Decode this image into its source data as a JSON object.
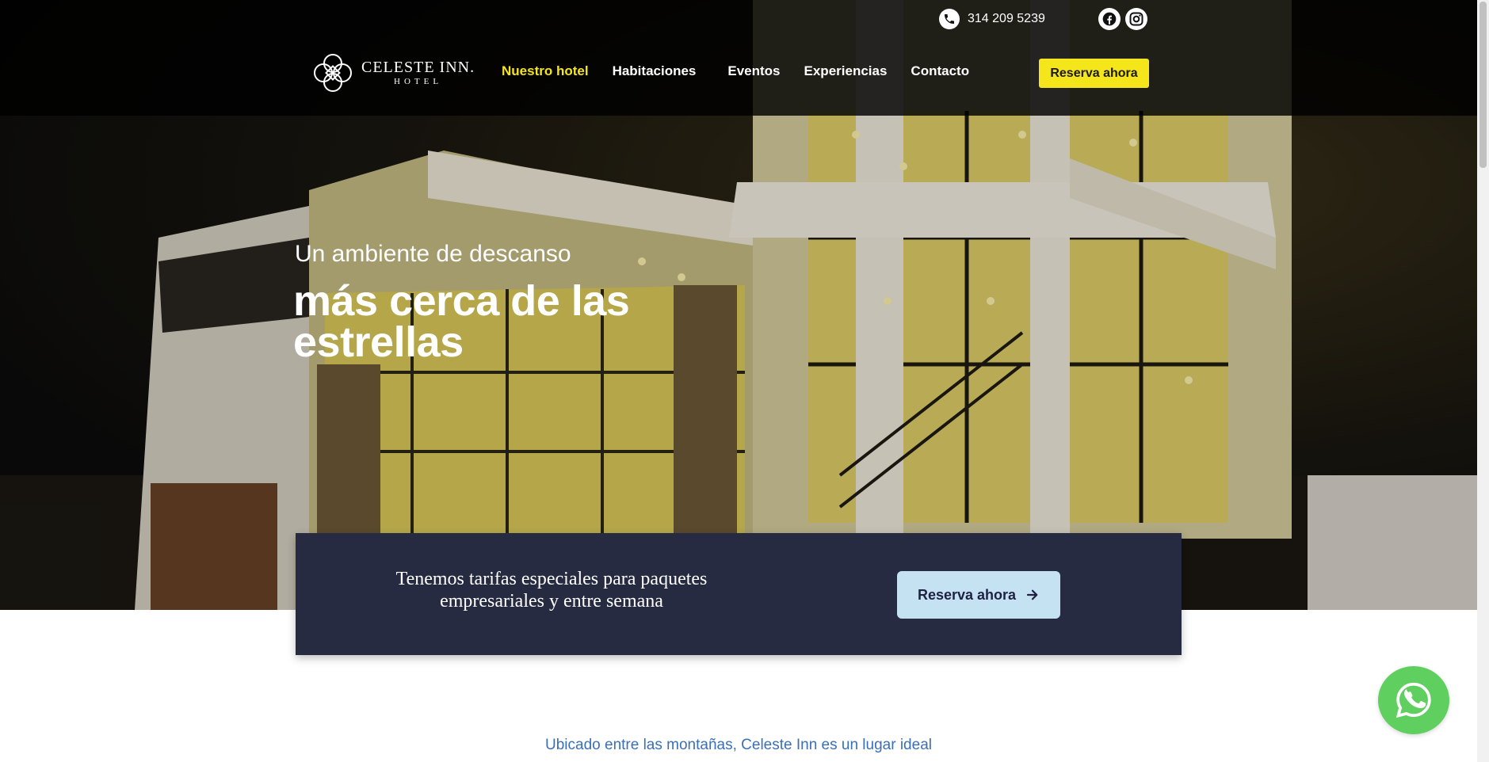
{
  "header": {
    "phone": "314 209 5239",
    "logo": {
      "main": "CELESTE INN.",
      "sub": "HOTEL"
    },
    "nav": [
      {
        "label": "Nuestro hotel",
        "active": true
      },
      {
        "label": "Habitaciones",
        "active": false
      },
      {
        "label": "Eventos",
        "active": false
      },
      {
        "label": "Experiencias",
        "active": false
      },
      {
        "label": "Contacto",
        "active": false
      }
    ],
    "cta_label": "Reserva ahora",
    "social": [
      "facebook-icon",
      "instagram-icon"
    ]
  },
  "hero": {
    "subtitle": "Un ambiente de descanso",
    "title": "más cerca de las estrellas"
  },
  "promo": {
    "text": "Tenemos tarifas especiales para paquetes empresariales y entre semana",
    "button_label": "Reserva ahora"
  },
  "intro": {
    "text": "Ubicado entre las montañas, Celeste Inn es un lugar ideal"
  },
  "colors": {
    "accent_yellow": "#f5e51b",
    "promo_bg": "#272b42",
    "promo_button": "#c5e2f3",
    "intro_text": "#3b6fb6",
    "whatsapp": "#5fcf5f"
  }
}
